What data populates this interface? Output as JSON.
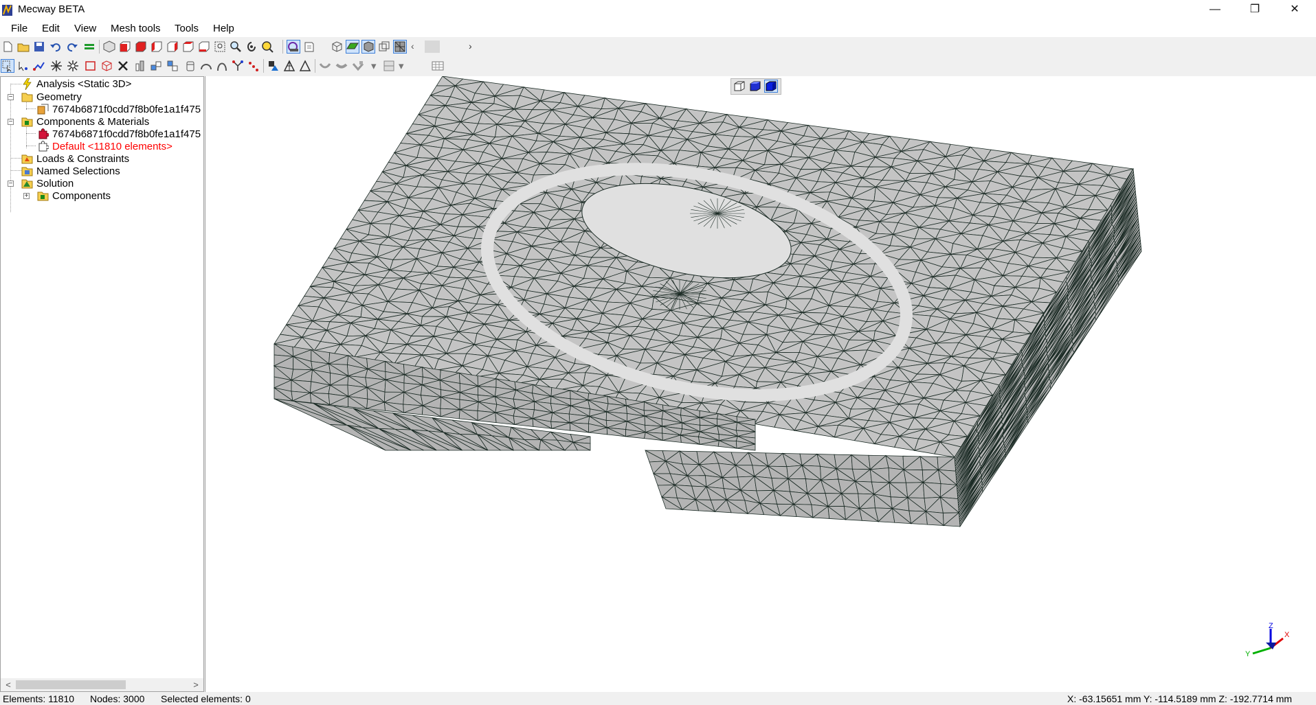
{
  "window": {
    "title": "Mecway BETA",
    "minimize_glyph": "—",
    "restore_glyph": "❐",
    "close_glyph": "✕"
  },
  "menu": [
    "File",
    "Edit",
    "View",
    "Mesh tools",
    "Tools",
    "Help"
  ],
  "toolbar1_icons": [
    "new-file-icon",
    "open-folder-icon",
    "save-icon",
    "undo-icon",
    "redo-icon",
    "equals-icon",
    "view-iso-icon",
    "view-front-icon",
    "view-back-icon",
    "view-left-icon",
    "view-right-icon",
    "view-top-icon",
    "view-bottom-icon",
    "zoom-box-icon",
    "zoom-icon",
    "rotate-icon",
    "zoom-fit-icon",
    "render-mode-icon",
    "display-mode-icon",
    "wireframe-icon",
    "shaded-icon",
    "shaded-solid-icon",
    "hidden-line-icon",
    "mesh-display-icon",
    "scroll-left-icon",
    "blank-icon",
    "scroll-right-icon"
  ],
  "toolbar2_icons": [
    "select-pointer-icon",
    "select-node-icon",
    "select-path-icon",
    "select-spread-icon",
    "select-radial-icon",
    "select-box-icon",
    "select-element-icon",
    "delete-icon",
    "extrude-icon",
    "refine-icon",
    "merge-icon",
    "sweep-icon",
    "revolve-icon",
    "arc-icon",
    "split-icon",
    "node-tool-icon",
    "material-icon",
    "mesh-tri-icon",
    "mesh-quad-icon",
    "smooth-icon",
    "bend-icon",
    "mirror-icon",
    "grid-icon"
  ],
  "tree": {
    "analysis": "Analysis <Static 3D>",
    "geometry": "Geometry",
    "geometry_item": "7674b6871f0cdd7f8b0fe1a1f475",
    "components": "Components & Materials",
    "component_item": "7674b6871f0cdd7f8b0fe1a1f475",
    "default_material": "Default <11810 elements>",
    "loads": "Loads & Constraints",
    "named_selections": "Named Selections",
    "solution": "Solution",
    "solution_components": "Components",
    "minus": "−",
    "plus": "+"
  },
  "scroll": {
    "left": "<",
    "right": ">"
  },
  "status": {
    "elements": "Elements: 11810",
    "nodes": "Nodes: 3000",
    "selected": "Selected elements: 0",
    "coords": "X: -63.15651 mm Y: -114.5189 mm Z: -192.7714 mm"
  },
  "axes": {
    "x": "X",
    "y": "Y",
    "z": "Z"
  },
  "colors": {
    "mesh_face": "#c4c4c4",
    "mesh_face_side": "#b4b4b4",
    "mesh_face_light": "#e0e0e0",
    "mesh_edge": "#1a2a24",
    "default_material_text": "#ff0000",
    "axis_x": "#e00000",
    "axis_y": "#00b000",
    "axis_z": "#0000e0"
  }
}
